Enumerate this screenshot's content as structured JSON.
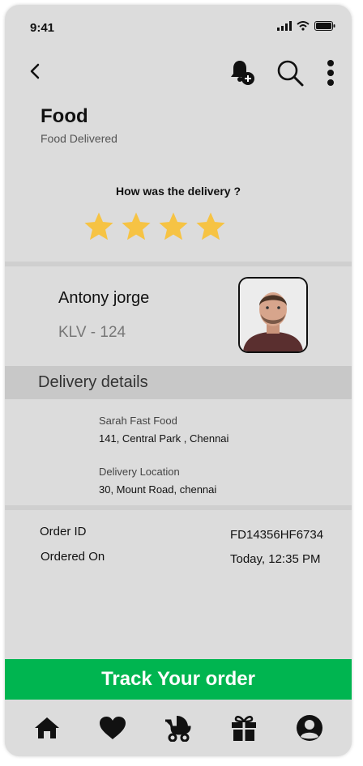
{
  "status_bar": {
    "time": "9:41",
    "icons": [
      "signal-icon",
      "wifi-icon",
      "battery-icon"
    ]
  },
  "top_bar": {
    "icons": [
      "back-chevron-icon",
      "bell-plus-icon",
      "search-icon",
      "more-vertical-icon"
    ]
  },
  "header": {
    "title": "Food",
    "subtitle": "Food Delivered"
  },
  "rating": {
    "question": "How was the delivery ?",
    "stars": 4,
    "max_stars": 4,
    "star_color": "#f6c344"
  },
  "driver": {
    "name": "Antony jorge",
    "vehicle": "KLV - 124"
  },
  "delivery_details": {
    "heading": "Delivery details",
    "restaurant_name": "Sarah Fast Food",
    "restaurant_address": "141, Central Park , Chennai",
    "location_label": "Delivery Location",
    "location_address": "30, Mount Road, chennai"
  },
  "order": {
    "id_label": "Order ID",
    "id_value": "FD14356HF6734",
    "ordered_on_label": "Ordered On",
    "ordered_on_value": "Today, 12:35 PM"
  },
  "cta": {
    "label": "Track Your order",
    "color": "#00b550"
  },
  "bottom_nav": {
    "items": [
      "home-icon",
      "heart-icon",
      "stroller-icon",
      "gift-icon",
      "profile-icon"
    ]
  }
}
